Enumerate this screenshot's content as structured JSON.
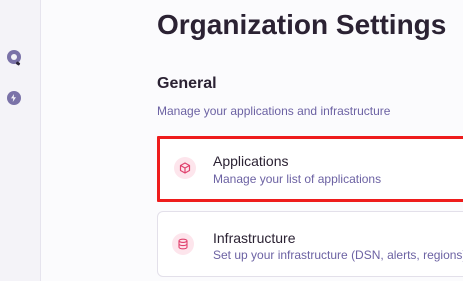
{
  "header": {
    "title": "Organization Settings"
  },
  "section": {
    "title": "General",
    "description": "Manage your applications and infrastructure"
  },
  "cards": [
    {
      "title": "Applications",
      "description": "Manage your list of applications",
      "icon": "cube-icon",
      "highlighted": true
    },
    {
      "title": "Infrastructure",
      "description": "Set up your infrastructure (DSN, alerts, regions)",
      "icon": "database-icon",
      "highlighted": false
    }
  ],
  "left_rail": {
    "icons": [
      "location-pin-icon",
      "lightning-icon"
    ]
  },
  "colors": {
    "title": "#2b2233",
    "muted_text": "#6c62a3",
    "accent_pink": "#e0426e",
    "highlight_border": "#ee1c1c"
  }
}
